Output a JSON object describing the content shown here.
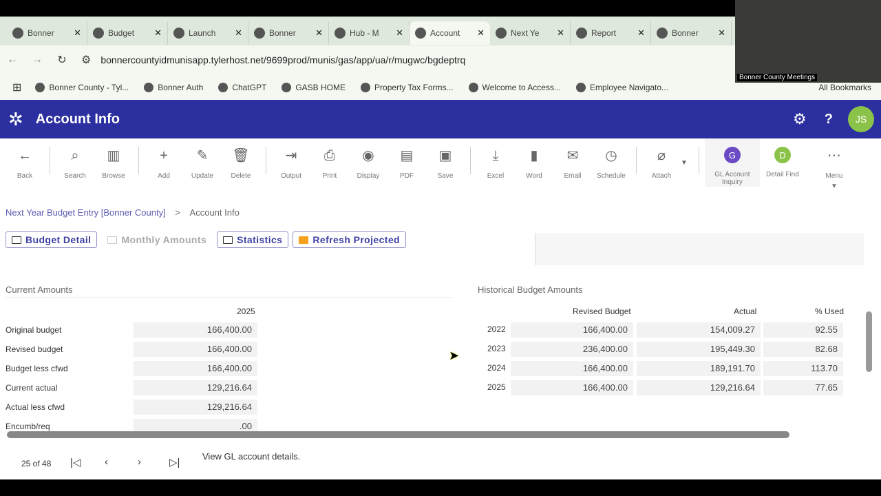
{
  "browser": {
    "tabs": [
      {
        "title": "Bonner",
        "icon": "phone-icon"
      },
      {
        "title": "Budget",
        "icon": "gmail-icon"
      },
      {
        "title": "Launch",
        "icon": "globe-icon"
      },
      {
        "title": "Bonner",
        "icon": "globe-icon"
      },
      {
        "title": "Hub - M",
        "icon": "tyler-icon"
      },
      {
        "title": "Account",
        "icon": "tyler-icon",
        "active": true
      },
      {
        "title": "Next Ye",
        "icon": "tyler-icon"
      },
      {
        "title": "Report",
        "icon": "pdf-icon"
      },
      {
        "title": "Bonner",
        "icon": "globe-icon"
      }
    ],
    "url": "bonnercountyidmunisapp.tylerhost.net/9699prod/munis/gas/app/ua/r/mugwc/bgdeptrq",
    "bookmarks": [
      "Bonner County - Tyl...",
      "Bonner Auth",
      "ChatGPT",
      "GASB HOME",
      "Property Tax Forms...",
      "Welcome to Access...",
      "Employee Navigato..."
    ],
    "all_bookmarks": "All Bookmarks"
  },
  "video": {
    "label": "Bonner County Meetings"
  },
  "app": {
    "title": "Account Info",
    "avatar": "JS"
  },
  "toolbar": [
    {
      "label": "Back",
      "icon": "←"
    },
    {
      "sep": true
    },
    {
      "label": "Search",
      "icon": "⌕"
    },
    {
      "label": "Browse",
      "icon": "▥"
    },
    {
      "sep": true
    },
    {
      "label": "Add",
      "icon": "+"
    },
    {
      "label": "Update",
      "icon": "✎"
    },
    {
      "label": "Delete",
      "icon": "🗑"
    },
    {
      "sep": true
    },
    {
      "label": "Output",
      "icon": "⇥"
    },
    {
      "label": "Print",
      "icon": "⎙"
    },
    {
      "label": "Display",
      "icon": "◉"
    },
    {
      "label": "PDF",
      "icon": "▤"
    },
    {
      "label": "Save",
      "icon": "▣"
    },
    {
      "sep": true
    },
    {
      "label": "Excel",
      "icon": "⤓"
    },
    {
      "label": "Word",
      "icon": "▮"
    },
    {
      "label": "Email",
      "icon": "✉"
    },
    {
      "label": "Schedule",
      "icon": "◷"
    },
    {
      "sep": true
    },
    {
      "label": "Attach",
      "icon": "⌀"
    }
  ],
  "toolbar_right": {
    "gl": {
      "letter": "G",
      "label": "GL Account Inquiry",
      "color": "#6a4bc4"
    },
    "df": {
      "letter": "D",
      "label": "Detail Find",
      "color": "#8bc34a"
    },
    "menu": "Menu"
  },
  "breadcrumb": {
    "parent": "Next Year Budget Entry [Bonner County]",
    "sep": ">",
    "current": "Account Info"
  },
  "buttons": [
    "Budget Detail",
    "Monthly Amounts",
    "Statistics",
    "Refresh Projected"
  ],
  "current": {
    "title": "Current Amounts",
    "year": "2025",
    "rows": [
      {
        "label": "Original budget",
        "value": "166,400.00"
      },
      {
        "label": "Revised budget",
        "value": "166,400.00"
      },
      {
        "label": "Budget less cfwd",
        "value": "166,400.00"
      },
      {
        "label": "Current actual",
        "value": "129,216.64"
      },
      {
        "label": "Actual less cfwd",
        "value": "129,216.64"
      },
      {
        "label": "Encumb/req",
        "value": ".00"
      }
    ]
  },
  "historical": {
    "title": "Historical Budget Amounts",
    "headers": [
      "Revised Budget",
      "Actual",
      "% Used"
    ],
    "rows": [
      {
        "year": "2022",
        "revised": "166,400.00",
        "actual": "154,009.27",
        "used": "92.55"
      },
      {
        "year": "2023",
        "revised": "236,400.00",
        "actual": "195,449.30",
        "used": "82.68"
      },
      {
        "year": "2024",
        "revised": "166,400.00",
        "actual": "189,191.70",
        "used": "113.70"
      },
      {
        "year": "2025",
        "revised": "166,400.00",
        "actual": "129,216.64",
        "used": "77.65"
      }
    ]
  },
  "footer": {
    "record": "25 of 48",
    "status": "View GL account details."
  }
}
